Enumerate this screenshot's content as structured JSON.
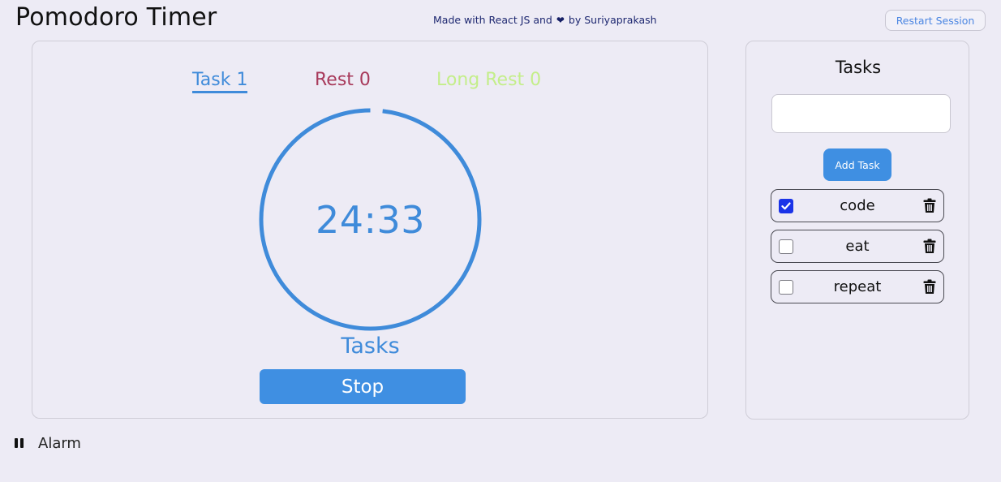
{
  "header": {
    "title": "Pomodoro Timer",
    "credit_before": "Made with React JS and",
    "credit_after": "by Suriyaprakash",
    "restart_label": "Restart Session"
  },
  "timer": {
    "tabs": [
      {
        "label": "Task 1",
        "color": "#3F8BDA",
        "active": true
      },
      {
        "label": "Rest 0",
        "color": "#A83A5B",
        "active": false
      },
      {
        "label": "Long Rest 0",
        "color": "#C4EE8A",
        "active": false
      }
    ],
    "time": "24:33",
    "mode_label": "Tasks",
    "stop_label": "Stop",
    "progress_remaining": 0.982,
    "ring_color": "#3F8BDA"
  },
  "tasks": {
    "title": "Tasks",
    "input_value": "",
    "add_label": "Add Task",
    "items": [
      {
        "label": "code",
        "done": true
      },
      {
        "label": "eat",
        "done": false
      },
      {
        "label": "repeat",
        "done": false
      }
    ]
  },
  "alarm": {
    "label": "Alarm",
    "icon": "pause-icon"
  },
  "colors": {
    "accent": "#3F8FE2",
    "background": "#EDEBF5",
    "credit_text": "#1D2770",
    "checkbox_checked": "#1A33E8"
  }
}
